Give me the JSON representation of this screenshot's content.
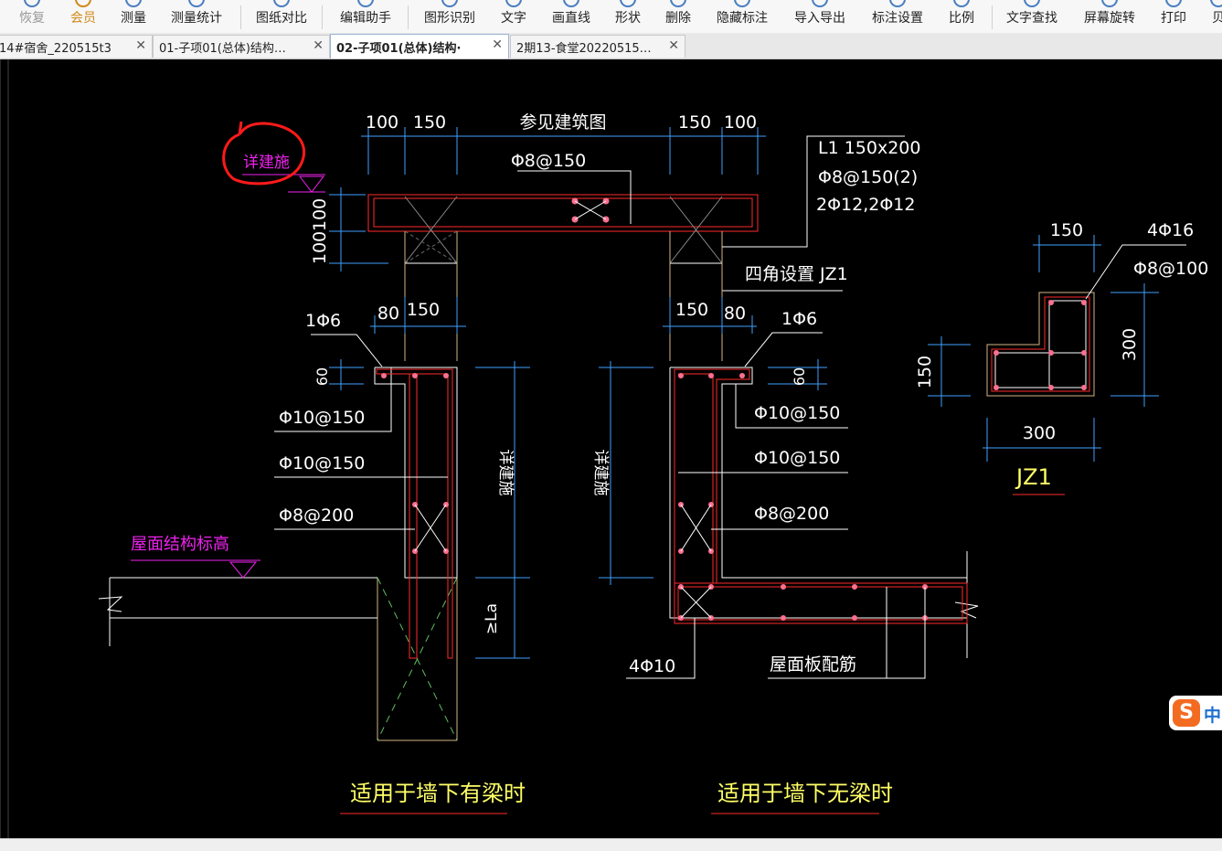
{
  "toolbar": {
    "items": [
      {
        "label": "恢复",
        "icon": "redo-icon",
        "state": "disabled"
      },
      {
        "label": "会员",
        "icon": "vip-icon",
        "state": "vip"
      },
      {
        "label": "测量",
        "icon": "measure-icon",
        "state": "normal"
      },
      {
        "label": "测量统计",
        "icon": "measure-stats-icon",
        "state": "normal"
      },
      {
        "label": "图纸对比",
        "icon": "compare-icon",
        "state": "normal"
      },
      {
        "label": "编辑助手",
        "icon": "edit-helper-icon",
        "state": "normal"
      },
      {
        "label": "图形识别",
        "icon": "shape-recognize-icon",
        "state": "normal"
      },
      {
        "label": "文字",
        "icon": "text-icon",
        "state": "normal"
      },
      {
        "label": "画直线",
        "icon": "line-icon",
        "state": "normal"
      },
      {
        "label": "形状",
        "icon": "shape-icon",
        "state": "normal"
      },
      {
        "label": "删除",
        "icon": "delete-icon",
        "state": "normal"
      },
      {
        "label": "隐藏标注",
        "icon": "hide-annotation-icon",
        "state": "normal"
      },
      {
        "label": "导入导出",
        "icon": "import-export-icon",
        "state": "normal"
      },
      {
        "label": "标注设置",
        "icon": "annotation-settings-icon",
        "state": "normal"
      },
      {
        "label": "比例",
        "icon": "scale-icon",
        "state": "normal"
      },
      {
        "label": "文字查找",
        "icon": "text-search-icon",
        "state": "normal"
      },
      {
        "label": "屏幕旋转",
        "icon": "rotate-icon",
        "state": "normal"
      },
      {
        "label": "打印",
        "icon": "print-icon",
        "state": "normal"
      },
      {
        "label": "贝",
        "icon": "more-icon",
        "state": "normal"
      }
    ]
  },
  "tabs": [
    {
      "label": "14#宿舍_220515t3",
      "active": false
    },
    {
      "label": "01-子项01(总体)结构…",
      "active": false
    },
    {
      "label": "02-子项01(总体)结构·",
      "active": true
    },
    {
      "label": "2期13-食堂20220515…",
      "active": false
    }
  ],
  "tab_close_glyph": "✕",
  "drawing": {
    "top_dims": [
      "100",
      "150",
      "参见建筑图",
      "150",
      "100"
    ],
    "top_rebar": "Φ8@150",
    "beam_label": [
      "L1 150x200",
      "Φ8@150(2)",
      "2Φ12,2Φ12"
    ],
    "corner_label": "四角设置 JZ1",
    "left_handwritten_note": "详建施",
    "left_height_dims": [
      "100",
      "100"
    ],
    "mid_dims_left": [
      "80",
      "150"
    ],
    "mid_dims_right": [
      "150",
      "80"
    ],
    "bar_1phi6_left": "1Φ6",
    "bar_1phi6_right": "1Φ6",
    "dim_60_left": "60",
    "dim_60_right": "60",
    "left_rebars": [
      "Φ10@150",
      "Φ10@150",
      "Φ8@200"
    ],
    "right_rebars": [
      "Φ10@150",
      "Φ10@150",
      "Φ8@200"
    ],
    "vert_label_left": "详建施",
    "vert_label_right": "详建施",
    "anchorage": "≥La",
    "roof_level": "屋面结构标高",
    "bottom_bar": "4Φ10",
    "slab_rebar": "屋面板配筋",
    "caption_left": "适用于墙下有梁时",
    "caption_right": "适用于墙下无梁时"
  },
  "jz1": {
    "dim_top": "150",
    "main_bar": "4Φ16",
    "stirrup": "Φ8@100",
    "dim_right": "300",
    "dim_left": "150",
    "dim_bottom": "300",
    "title": "JZ1"
  },
  "colors": {
    "canvas_bg": "#000000",
    "dim_blue": "#3fa0ff",
    "white_line": "#ffffff",
    "red_outline": "#ff2a2a",
    "rebar_pink": "#ff6f8f",
    "yellow": "#ffff66",
    "magenta": "#ee22ee",
    "annotation_red": "#ff1a1a",
    "wall_tan": "#d4b483"
  },
  "ime": {
    "logo": "S",
    "lang": "中"
  }
}
